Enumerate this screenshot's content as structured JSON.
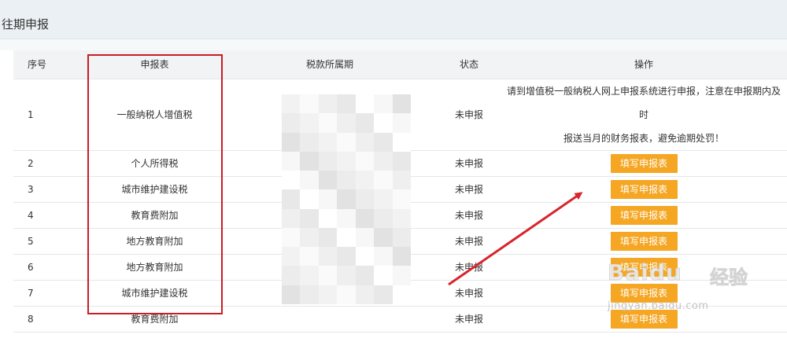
{
  "page": {
    "title": "往期申报"
  },
  "table": {
    "headers": {
      "index": "序号",
      "form": "申报表",
      "period": "税款所属期",
      "status": "状态",
      "action": "操作"
    },
    "notice": {
      "line1": "请到增值税一般纳税人网上申报系统进行申报，注意在申报期内及时",
      "line2": "报送当月的财务报表，避免逾期处罚！"
    },
    "rows": [
      {
        "index": "1",
        "form": "一般纳税人增值税",
        "status": "未申报"
      },
      {
        "index": "2",
        "form": "个人所得税",
        "status": "未申报",
        "action": "填写申报表"
      },
      {
        "index": "3",
        "form": "城市维护建设税",
        "status": "未申报",
        "action": "填写申报表"
      },
      {
        "index": "4",
        "form": "教育费附加",
        "status": "未申报",
        "action": "填写申报表"
      },
      {
        "index": "5",
        "form": "地方教育附加",
        "status": "未申报",
        "action": "填写申报表"
      },
      {
        "index": "6",
        "form": "地方教育附加",
        "status": "未申报",
        "action": "填写申报表"
      },
      {
        "index": "7",
        "form": "城市维护建设税",
        "status": "未申报",
        "action": "填写申报表"
      },
      {
        "index": "8",
        "form": "教育费附加",
        "status": "未申报",
        "action": "填写申报表"
      }
    ]
  },
  "watermark": {
    "brand": "Baidu",
    "suffix": "经验",
    "url": "jingyan.baidu.com"
  },
  "colors": {
    "button": "#f5a623",
    "highlight": "#c91c25",
    "arrow": "#d6262d",
    "header_bg": "#eaf0f3"
  }
}
